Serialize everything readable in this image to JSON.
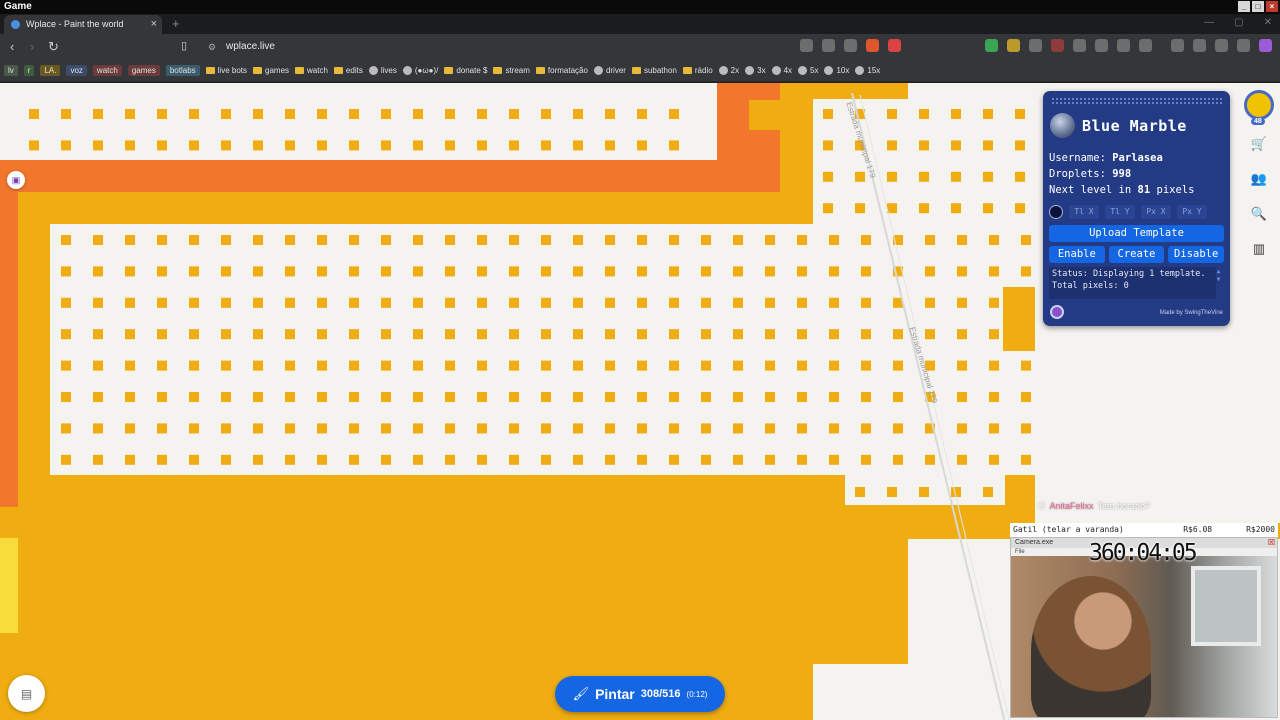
{
  "os": {
    "title": "Game"
  },
  "browser": {
    "tab_title": "Wplace - Paint the world",
    "url": "wplace.live"
  },
  "bookmarks": [
    {
      "label": "lv",
      "color": "#4a5a4a"
    },
    {
      "label": "r",
      "color": "#3d5f3d"
    },
    {
      "label": "LA.",
      "color": "#6b5a1e"
    },
    {
      "label": "voz",
      "color": "#3b4c6b"
    },
    {
      "label": "watch",
      "color": "#6b3b3b"
    },
    {
      "label": "games",
      "color": "#6b3b3b"
    },
    {
      "label": "botlabs",
      "color": "#3b5c6b"
    },
    {
      "label": "live bots",
      "type": "folder"
    },
    {
      "label": "games",
      "type": "folder"
    },
    {
      "label": "watch",
      "type": "folder"
    },
    {
      "label": "edits",
      "type": "folder"
    },
    {
      "label": "lives",
      "type": "icon"
    },
    {
      "label": "(●ω●)/",
      "type": "icon"
    },
    {
      "label": "donate $",
      "type": "folder"
    },
    {
      "label": "stream",
      "type": "folder"
    },
    {
      "label": "formatação",
      "type": "folder"
    },
    {
      "label": "driver",
      "type": "icon"
    },
    {
      "label": "subathon",
      "type": "folder"
    },
    {
      "label": "rádio",
      "type": "folder"
    },
    {
      "label": "2x",
      "type": "icon"
    },
    {
      "label": "3x",
      "type": "icon"
    },
    {
      "label": "4x",
      "type": "icon"
    },
    {
      "label": "5x",
      "type": "icon"
    },
    {
      "label": "10x",
      "type": "icon"
    },
    {
      "label": "15x",
      "type": "icon"
    }
  ],
  "map": {
    "road_labels": [
      "Estrada municipal 179",
      "Estrada municipal 179"
    ],
    "colors": {
      "gold": "#efad12",
      "orange": "#f2772d",
      "yellow": "#f7dc3c",
      "ground": "#f4f3ef"
    }
  },
  "right_rail": {
    "level_badge": "48",
    "icons": [
      "cart-icon",
      "community-icon",
      "search-icon",
      "leaderboard-icon"
    ]
  },
  "blue_marble": {
    "title": "Blue Marble",
    "username_label": "Username:",
    "username": "Parlasea",
    "droplets_label": "Droplets:",
    "droplets": "998",
    "next_level_prefix": "Next level in",
    "next_level_count": "81",
    "next_level_suffix": "pixels",
    "coord_placeholders": [
      "Tl X",
      "Tl Y",
      "Px X",
      "Px Y"
    ],
    "upload_label": "Upload Template",
    "enable_label": "Enable",
    "create_label": "Create",
    "disable_label": "Disable",
    "status_text": "Status: Displaying 1 template.",
    "status_text_2": "Total pixels: 0",
    "credit": "Made by SwingTheVine"
  },
  "chat": {
    "user": "AnitaFelixx",
    "message": "Tem horario?"
  },
  "stream_overlay": {
    "goal_label": "Gatil (telar a varanda)",
    "goal_current": "R$6.08",
    "goal_target": "R$2000",
    "cam_title": "Camera.exe",
    "cam_menu": "File",
    "timer": "360:04:05"
  },
  "paint_button": {
    "label": "Pintar",
    "count": "308/516",
    "timer": "(0:12)"
  }
}
